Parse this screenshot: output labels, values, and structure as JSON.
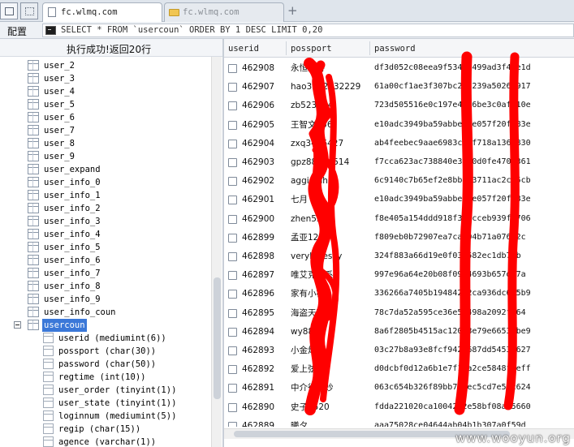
{
  "tabs": [
    {
      "title": "fc.wlmq.com",
      "active": true
    },
    {
      "title": "fc.wlmq.com",
      "active": false
    }
  ],
  "icons": {
    "new_tab": "+",
    "close": "✕"
  },
  "query": {
    "config_label": "配置",
    "sql": "SELECT * FROM `usercoun` ORDER BY 1 DESC LIMIT 0,20"
  },
  "status": "执行成功!返回20行",
  "tree": {
    "tables": [
      "user_2",
      "user_3",
      "user_4",
      "user_5",
      "user_6",
      "user_7",
      "user_8",
      "user_9",
      "user_expand",
      "user_info_0",
      "user_info_1",
      "user_info_2",
      "user_info_3",
      "user_info_4",
      "user_info_5",
      "user_info_6",
      "user_info_7",
      "user_info_8",
      "user_info_9",
      "user_info_coun"
    ],
    "selected_table": "usercoun",
    "columns": [
      "userid (mediumint(6))",
      "possport (char(30))",
      "password (char(50))",
      "regtime (int(10))",
      "user_order (tinyint(1))",
      "user_state (tinyint(1))",
      "loginnum (mediumint(5))",
      "regip (char(15))",
      "agence (varchar(1))"
    ]
  },
  "grid": {
    "columns": [
      "userid",
      "possport",
      "password"
    ],
    "rows": [
      {
        "userid": "462908",
        "possport": "永恒之诗",
        "password": "df3d052c08eea9f534be499ad3f4de1d"
      },
      {
        "userid": "462907",
        "possport": "hao3232432229",
        "password": "61a00cf1ae3f307bc29a239a5026c917"
      },
      {
        "userid": "462906",
        "possport": "zb523654",
        "password": "723d505516e0c197e42e6be3c0afb10e"
      },
      {
        "userid": "462905",
        "possport": "王智文456",
        "password": "e10adc3949ba59abbe56e057f20f883e"
      },
      {
        "userid": "462904",
        "possport": "zxq3456427",
        "password": "ab4feebec9aae6983cbbf718a136f830"
      },
      {
        "userid": "462903",
        "possport": "gpz88864514",
        "password": "f7cca623ac738840e3040d0fe4706361"
      },
      {
        "userid": "462902",
        "possport": "aggiefahan",
        "password": "6c9140c7b65ef2e8bb493711ac2c35cb"
      },
      {
        "userid": "462901",
        "possport": "七月",
        "password": "e10adc3949ba59abbe56e057f20f883e"
      },
      {
        "userid": "462900",
        "possport": "zhen5sd8",
        "password": "f8e405a154ddd918f321cceb939f7706"
      },
      {
        "userid": "462899",
        "possport": "孟亚122",
        "password": "f809eb0b72907ea7ca404b71a07622c"
      },
      {
        "userid": "462898",
        "possport": "verybluesky",
        "password": "324f883a66d19e0f034582ec1db70b"
      },
      {
        "userid": "462897",
        "possport": "唯艾克斯系",
        "password": "997e96a64e20b08f0914693b657d97a"
      },
      {
        "userid": "462896",
        "possport": "家有小桐",
        "password": "336266a7405b19484212ca936dc6c5b9"
      },
      {
        "userid": "462895",
        "possport": "海盗天下wl",
        "password": "78c7da52a595ce36e51498a2092f464"
      },
      {
        "userid": "462894",
        "possport": "wy8888",
        "password": "8a6f2805b4515ac12038e79e6653fbe9"
      },
      {
        "userid": "462893",
        "possport": "小金灿",
        "password": "03c27b8a93e8fcf9427687dd5453b627"
      },
      {
        "userid": "462892",
        "possport": "爱上弦月",
        "password": "d0dcbf0d12a6b1e7f15a2ce5848feeff"
      },
      {
        "userid": "462891",
        "possport": "中介很奇妙",
        "password": "063c654b326f89bb735ec5cd7e50c624"
      },
      {
        "userid": "462890",
        "possport": "史子3520",
        "password": "fdda221020ca1004232e58bf08a55660"
      },
      {
        "userid": "462889",
        "possport": "曦夕",
        "password": "aaa75028ce04644ab04b1b307a0f59d"
      }
    ]
  },
  "redaction_color": "#ff0000",
  "watermark": "www.wooyun.org"
}
